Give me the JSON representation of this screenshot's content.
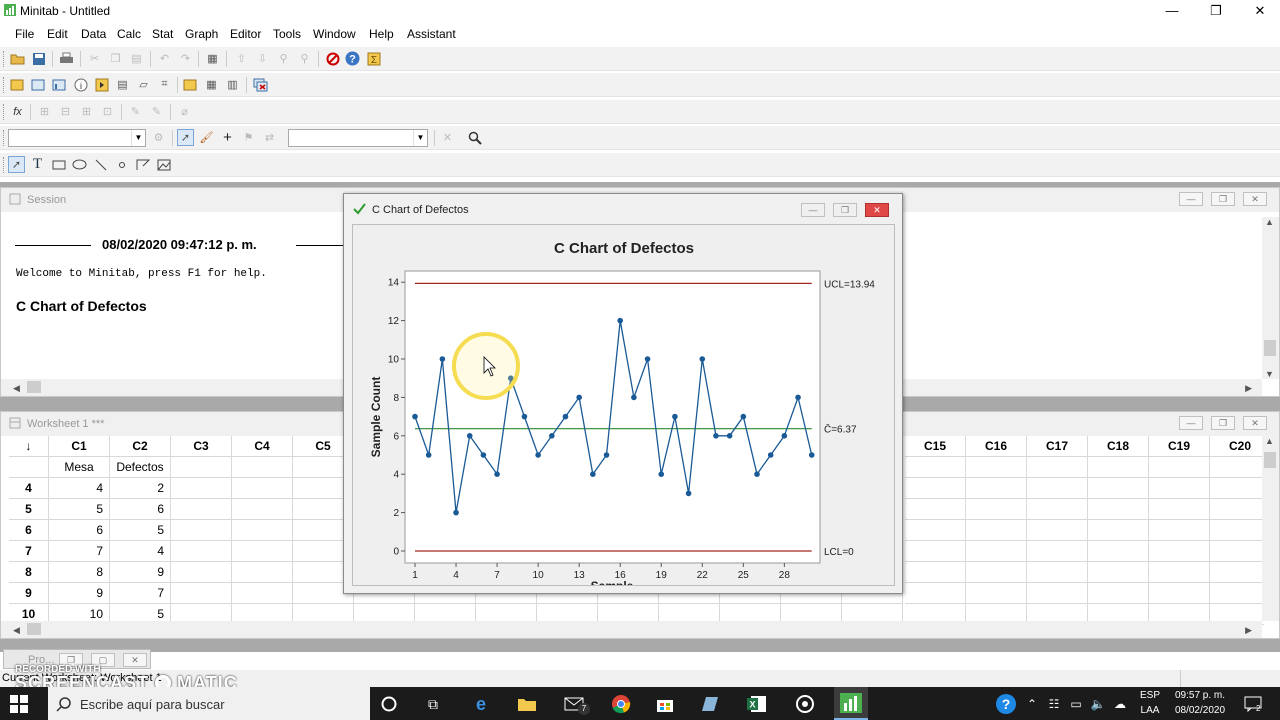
{
  "window": {
    "title": "Minitab - Untitled",
    "minimize": "—",
    "restore": "❐",
    "close": "✕"
  },
  "menu": [
    "File",
    "Edit",
    "Data",
    "Calc",
    "Stat",
    "Graph",
    "Editor",
    "Tools",
    "Window",
    "Help",
    "Assistant"
  ],
  "colors": {
    "workspace": "#a9a9a9",
    "control_limit": "#a0281e",
    "center_line": "#2d8a2d",
    "series": "#1a5a96",
    "highlight_ring": "#f5dc50"
  },
  "session": {
    "title": "Session",
    "timestamp": "08/02/2020 09:47:12 p. m.",
    "welcome": "Welcome to Minitab, press F1 for help.",
    "heading": "C Chart of Defectos"
  },
  "worksheet": {
    "title": "Worksheet 1 ***",
    "corner": "↓",
    "columns_left": [
      "C1",
      "C2",
      "C3",
      "C4",
      "C5"
    ],
    "columns_right": [
      "C15",
      "C16",
      "C17",
      "C18",
      "C19",
      "C20"
    ],
    "names": [
      "Mesa",
      "Defectos"
    ],
    "rows": [
      {
        "row": "4",
        "mesa": "4",
        "def": "2"
      },
      {
        "row": "5",
        "mesa": "5",
        "def": "6"
      },
      {
        "row": "6",
        "mesa": "6",
        "def": "5"
      },
      {
        "row": "7",
        "mesa": "7",
        "def": "4"
      },
      {
        "row": "8",
        "mesa": "8",
        "def": "9"
      },
      {
        "row": "9",
        "mesa": "9",
        "def": "7"
      },
      {
        "row": "10",
        "mesa": "10",
        "def": "5"
      }
    ]
  },
  "chart_window": {
    "title": "C Chart of Defectos"
  },
  "chart_data": {
    "type": "line",
    "title": "C Chart of Defectos",
    "xlabel": "Sample",
    "ylabel": "Sample Count",
    "xticks": [
      "1",
      "4",
      "7",
      "10",
      "13",
      "16",
      "19",
      "22",
      "25",
      "28"
    ],
    "yticks": [
      "0",
      "2",
      "4",
      "6",
      "8",
      "10",
      "12",
      "14"
    ],
    "ylim": [
      0,
      14
    ],
    "xlim": [
      1,
      30
    ],
    "x": [
      1,
      2,
      3,
      4,
      5,
      6,
      7,
      8,
      9,
      10,
      11,
      12,
      13,
      14,
      15,
      16,
      17,
      18,
      19,
      20,
      21,
      22,
      23,
      24,
      25,
      26,
      27,
      28,
      29,
      30
    ],
    "values": [
      7,
      5,
      10,
      2,
      6,
      5,
      4,
      9,
      7,
      5,
      6,
      7,
      8,
      4,
      5,
      12,
      8,
      10,
      4,
      7,
      3,
      10,
      6,
      6,
      7,
      4,
      5,
      6,
      8,
      5
    ],
    "ucl": 13.94,
    "center": 6.37,
    "lcl": 0,
    "ucl_label": "UCL=13.94",
    "center_label": "C̄=6.37",
    "lcl_label": "LCL=0",
    "grid": false
  },
  "statusbar": {
    "text": "Current Worksheet: Worksheet 1"
  },
  "watermark": {
    "line1": "RECORDED WITH",
    "line2": "SCREENCAST",
    "line3": "MATIC"
  },
  "minimized": {
    "label": "Pro..."
  },
  "taskbar": {
    "search": "Escribe aquí para buscar",
    "lang1": "ESP",
    "lang2": "LAA",
    "time": "09:57 p. m.",
    "date": "08/02/2020",
    "badge": "7",
    "notif": "2"
  }
}
